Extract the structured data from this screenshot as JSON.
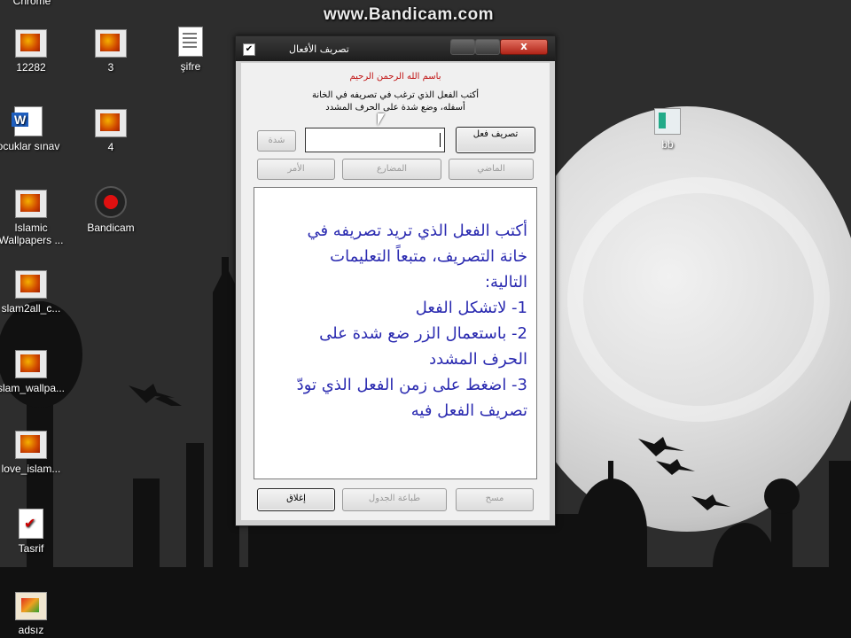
{
  "watermark": "www.Bandicam.com",
  "desktop": {
    "top_label": "Chrome",
    "icons": [
      {
        "label": "12282"
      },
      {
        "label": "3"
      },
      {
        "label": "şifre"
      },
      {
        "label": "ocuklar sınav"
      },
      {
        "label": "4"
      },
      {
        "label": "Islamic Wallpapers ..."
      },
      {
        "label": "Bandicam"
      },
      {
        "label": "slam2all_c..."
      },
      {
        "label": "slam_wallpa..."
      },
      {
        "label": "love_islam..."
      },
      {
        "label": "Tasrif"
      },
      {
        "label": "adsız"
      },
      {
        "label": "bb"
      }
    ]
  },
  "window": {
    "title": "تصريف الأفعال",
    "close_label": "x",
    "basmala": "باسم الله الرحمن الرحيم",
    "instruction_1": "أكتب الفعل الذي ترغب في تصريفه في الخانة",
    "instruction_2": "أسفله، وضع شدة على الحرف المشدد",
    "buttons": {
      "conjugate": "تصريف فعل",
      "shadda": "شدة",
      "past": "الماضي",
      "present": "المضارع",
      "imperative": "الأمر",
      "close": "إغلاق",
      "print_table": "طباعة الجدول",
      "clear": "مسح"
    },
    "verb_input_value": "",
    "memo_lines": [
      "أكتب الفعل الذي تريد تصريفه في",
      "خانة التصريف، متبعاً التعليمات",
      "التالية:",
      "1- لاتشكل الفعل",
      "2- باستعمال الزر ضع شدة على",
      "الحرف المشدد",
      "3- اضغط على زمن الفعل الذي تودّ",
      "تصريف الفعل فيه"
    ]
  }
}
